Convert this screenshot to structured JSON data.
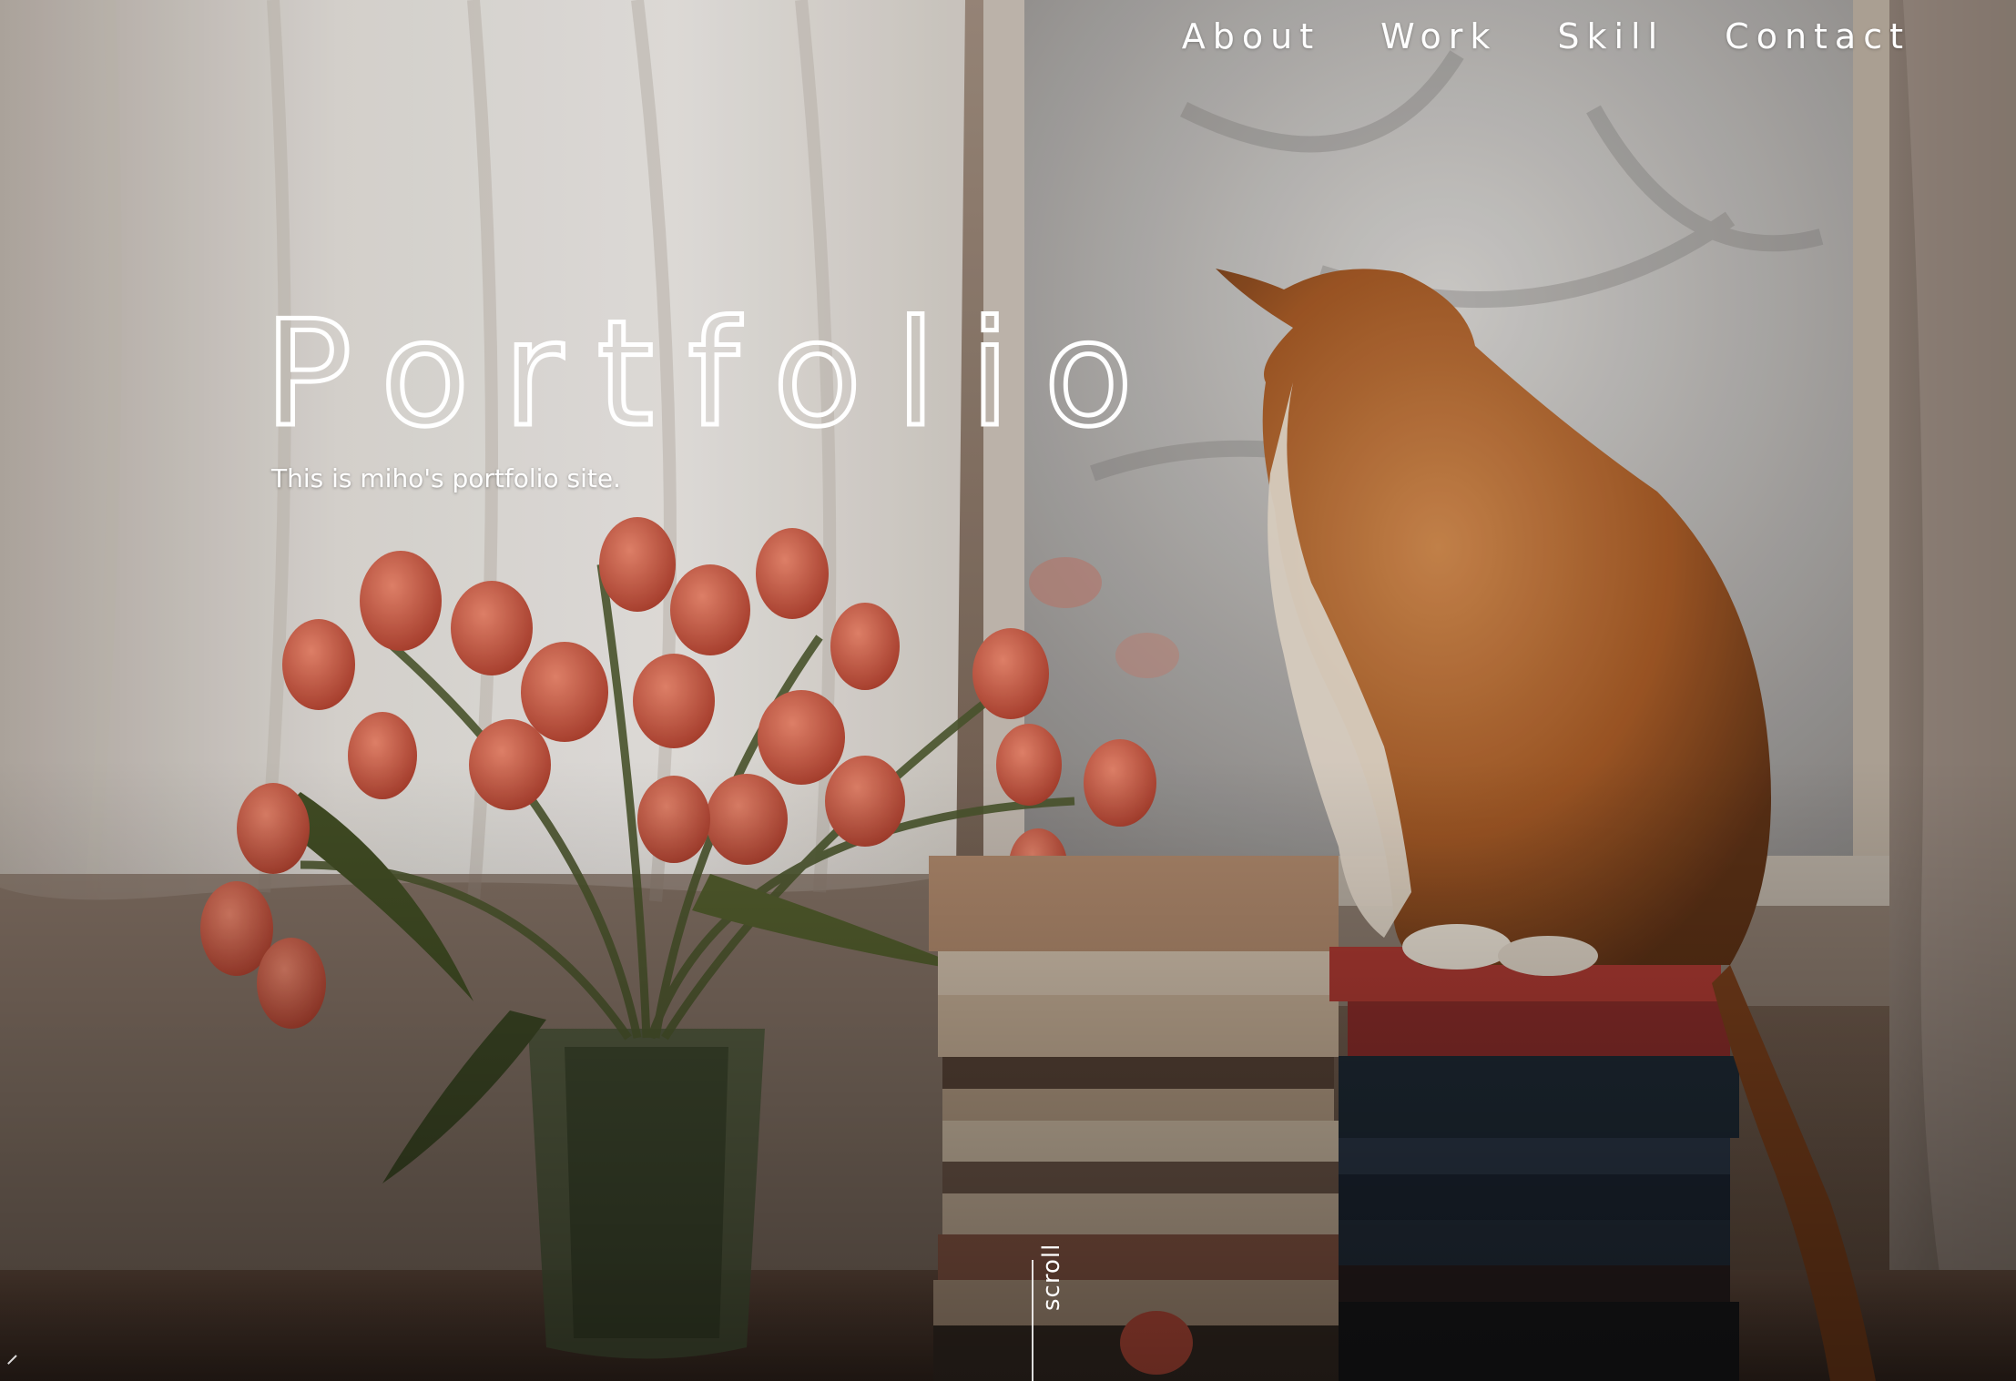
{
  "nav": {
    "items": [
      {
        "label": "About"
      },
      {
        "label": "Work"
      },
      {
        "label": "Skill"
      },
      {
        "label": "Contact"
      }
    ]
  },
  "hero": {
    "title": "Portfolio",
    "subtitle": "This is miho's portfolio site.",
    "scroll_label": "scroll"
  },
  "colors": {
    "text": "#ffffff",
    "accent_tulip": "#d9674f",
    "cat_fur": "#b8652a"
  },
  "icons": {
    "scroll_arrow": "arrow-down-icon"
  }
}
